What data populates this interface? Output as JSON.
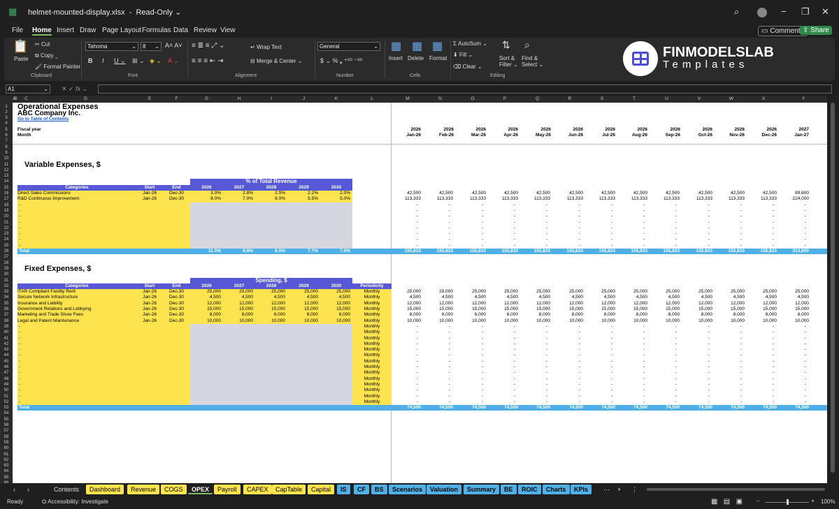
{
  "window": {
    "filename": "helmet-mounted-display.xlsx",
    "mode": "Read-Only"
  },
  "menu": [
    "File",
    "Home",
    "Insert",
    "Draw",
    "Page Layout",
    "Formulas",
    "Data",
    "Review",
    "View"
  ],
  "buttons": {
    "comments": "Comments",
    "share": "Share"
  },
  "ribbon": {
    "paste": "Paste",
    "cut": "Cut",
    "copy": "Copy",
    "format_painter": "Format Painter",
    "clipboard": "Clipboard",
    "font_name": "Tahoma",
    "font_size": "8",
    "font": "Font",
    "wrap": "Wrap Text",
    "merge": "Merge & Center",
    "alignment": "Alignment",
    "number_format": "General",
    "number": "Number",
    "insert": "Insert",
    "delete": "Delete",
    "format": "Format",
    "cells": "Cells",
    "autosum": "AutoSum",
    "fill": "Fill",
    "clear": "Clear",
    "sort": "Sort &",
    "filter": "Filter",
    "find": "Find &",
    "select": "Select",
    "editing": "Editing",
    "logo_top": "FINMODELSLAB",
    "logo_bottom": "Templates"
  },
  "namebox": "A1",
  "col_letters": [
    "A",
    "B",
    "C",
    "D",
    "E",
    "F",
    "G",
    "H",
    "I",
    "J",
    "K",
    "L",
    "M",
    "N",
    "O",
    "P",
    "Q",
    "R",
    "S",
    "T",
    "U",
    "V",
    "W",
    "X",
    "Y"
  ],
  "sheet": {
    "title": "Operational Expenses",
    "company": "ABC Company Inc.",
    "link": "Go to Table of Contents",
    "fiscal_year": "Fiscal year",
    "month": "Month",
    "years": [
      "2026",
      "2026",
      "2026",
      "2026",
      "2026",
      "2026",
      "2026",
      "2026",
      "2026",
      "2026",
      "2026",
      "2026",
      "2027"
    ],
    "months": [
      "Jan-26",
      "Feb-26",
      "Mar-26",
      "Apr-26",
      "May-26",
      "Jun-26",
      "Jul-26",
      "Aug-26",
      "Sep-26",
      "Oct-26",
      "Nov-26",
      "Dec-26",
      "Jan-27"
    ],
    "var_title": "Variable Expenses, $",
    "pct_header": "% of Total Revenue",
    "hdr": {
      "categories": "Categories",
      "start": "Start",
      "end": "End",
      "periodicity": "Periodicity",
      "total": "Total"
    },
    "plan_years": [
      "2026",
      "2027",
      "2028",
      "2029",
      "2030"
    ],
    "var_rows": [
      {
        "name": "Direct Sales Commissions",
        "start": "Jan-26",
        "end": "Dec-30",
        "pct": [
          "3.0%",
          "2.8%",
          "2.5%",
          "2.2%",
          "2.0%"
        ],
        "monthly": [
          "42,500",
          "42,500",
          "42,500",
          "42,500",
          "42,500",
          "42,500",
          "42,500",
          "42,500",
          "42,500",
          "42,500",
          "42,500",
          "42,500",
          "89,600"
        ]
      },
      {
        "name": "R&D Continuous Improvement",
        "start": "Jan-26",
        "end": "Dec-30",
        "pct": [
          "8.0%",
          "7.0%",
          "6.0%",
          "5.5%",
          "5.0%"
        ],
        "monthly": [
          "113,333",
          "113,333",
          "113,333",
          "113,333",
          "113,333",
          "113,333",
          "113,333",
          "113,333",
          "113,333",
          "113,333",
          "113,333",
          "113,333",
          "224,000"
        ]
      }
    ],
    "var_total_pct": [
      "11.0%",
      "9.8%",
      "8.5%",
      "7.7%",
      "7.0%"
    ],
    "var_total_monthly": [
      "155,833",
      "155,833",
      "155,833",
      "155,833",
      "155,833",
      "155,833",
      "155,833",
      "155,833",
      "155,833",
      "155,833",
      "155,833",
      "155,833",
      "313,600"
    ],
    "fixed_title": "Fixed Expenses, $",
    "spend_header": "Spending, $",
    "fixed_rows": [
      {
        "name": "ITAR Compliant Facility Rent",
        "start": "Jan-26",
        "end": "Dec-30",
        "vals": [
          "25,000",
          "25,000",
          "25,000",
          "25,000",
          "25,000"
        ],
        "per": "Monthly",
        "monthly": "25,000"
      },
      {
        "name": "Secure Network Infrastructure",
        "start": "Jan-26",
        "end": "Dec-30",
        "vals": [
          "4,500",
          "4,500",
          "4,500",
          "4,500",
          "4,500"
        ],
        "per": "Monthly",
        "monthly": "4,500"
      },
      {
        "name": "Insurance and Liability",
        "start": "Jan-26",
        "end": "Dec-30",
        "vals": [
          "12,000",
          "12,000",
          "12,000",
          "12,000",
          "12,000"
        ],
        "per": "Monthly",
        "monthly": "12,000"
      },
      {
        "name": "Government Relations and Lobbying",
        "start": "Jan-26",
        "end": "Dec-30",
        "vals": [
          "15,000",
          "15,000",
          "15,000",
          "15,000",
          "15,000"
        ],
        "per": "Monthly",
        "monthly": "15,000"
      },
      {
        "name": "Marketing and Trade Show Fees",
        "start": "Jan-26",
        "end": "Dec-30",
        "vals": [
          "8,000",
          "8,000",
          "8,000",
          "8,000",
          "8,000"
        ],
        "per": "Monthly",
        "monthly": "8,000"
      },
      {
        "name": "Legal and Patent Maintenance",
        "start": "Jan-26",
        "end": "Dec-30",
        "vals": [
          "10,000",
          "10,000",
          "10,000",
          "10,000",
          "10,000"
        ],
        "per": "Monthly",
        "monthly": "10,000"
      }
    ],
    "fixed_total_monthly": "74,500"
  },
  "tabs": [
    "Contents",
    "Dashboard",
    "Revenue",
    "COGS",
    "OPEX",
    "Payroll",
    "CAPEX",
    "CapTable",
    "Capital",
    "IS",
    "CF",
    "BS",
    "Scenarios",
    "Valuation",
    "Summary",
    "BE",
    "ROIC",
    "Charts",
    "KPIs"
  ],
  "status": {
    "ready": "Ready",
    "access": "Accessibility: Investigate",
    "zoom": "100%"
  }
}
